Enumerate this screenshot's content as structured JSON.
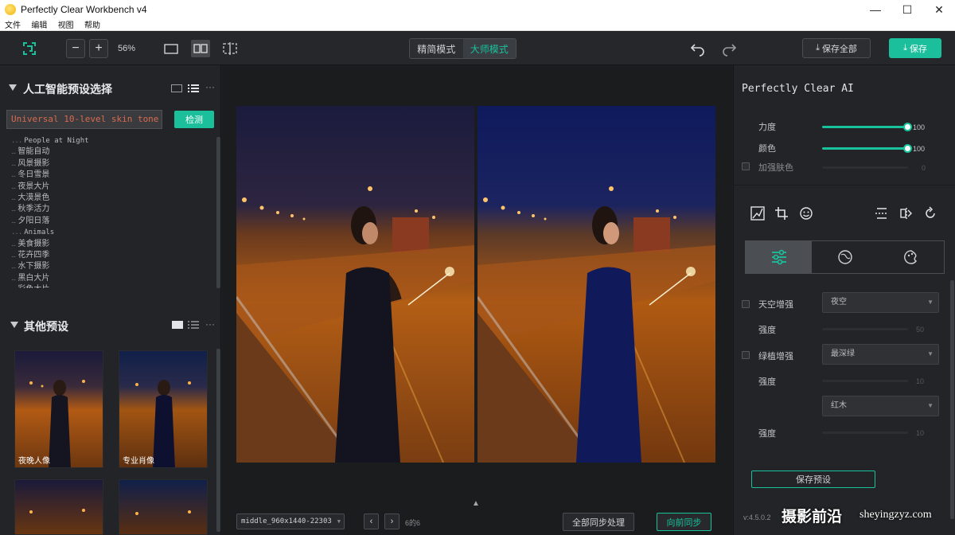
{
  "window": {
    "title": "Perfectly Clear Workbench v4",
    "controls": {
      "minimize": "—",
      "maximize": "☐",
      "close": "✕"
    }
  },
  "menu": [
    "文件",
    "编辑",
    "视图",
    "帮助"
  ],
  "toolbar": {
    "zoom_out": "−",
    "zoom_in": "+",
    "zoom_level": "56%",
    "mode_simple": "精简模式",
    "mode_master": "大师模式",
    "save_all": "保存全部",
    "save": "保存"
  },
  "left": {
    "ai_section_title": "人工智能预设选择",
    "preset_value": "Universal 10-level skin tone",
    "detect_button": "检测",
    "tree_items": [
      "People at Night",
      "智能自动",
      "风景摄影",
      "冬日雪景",
      "夜景大片",
      "大漠景色",
      "秋季活力",
      "夕阳日落",
      "Animals",
      "美食摄影",
      "花卉四季",
      "水下摄影",
      "黑白大片",
      "彩色大片"
    ],
    "other_section_title": "其他预设",
    "thumbnails": [
      {
        "label": "夜晚人像",
        "style": "warm"
      },
      {
        "label": "专业肖像",
        "style": "cool"
      },
      {
        "label": "",
        "style": "warm"
      },
      {
        "label": "",
        "style": "cool"
      }
    ]
  },
  "center": {
    "file_select": "middle_960x1440-22303",
    "page_info": "6的6",
    "sync_all": "全部同步处理",
    "sync_forward": "向前同步",
    "collapse": "▲"
  },
  "right": {
    "title": "Perfectly Clear AI",
    "strength_label": "力度",
    "strength_value": "100",
    "color_label": "颜色",
    "color_value": "100",
    "skin_label": "加强肤色",
    "skin_value": "0",
    "sky_label": "天空增强",
    "sky_option": "夜空",
    "sky_strength_label": "强度",
    "sky_strength_value": "50",
    "green_label": "绿植增强",
    "green_option": "最深绿",
    "green_strength_label": "强度",
    "green_strength_value": "10",
    "wood_option": "红木",
    "wood_strength_label": "强度",
    "wood_strength_value": "10",
    "save_preset": "保存预设",
    "version": "v:4.5.0.2",
    "watermark": "摄影前沿",
    "watermark_url": "sheyingzyz.com"
  },
  "colors": {
    "accent": "#18c29c",
    "background": "#1e1f21",
    "panel": "#232427"
  },
  "sliders": {
    "strength": 100,
    "color": 100,
    "skin": 0,
    "sky_strength": 50,
    "green_strength": 10,
    "wood_strength": 10
  }
}
